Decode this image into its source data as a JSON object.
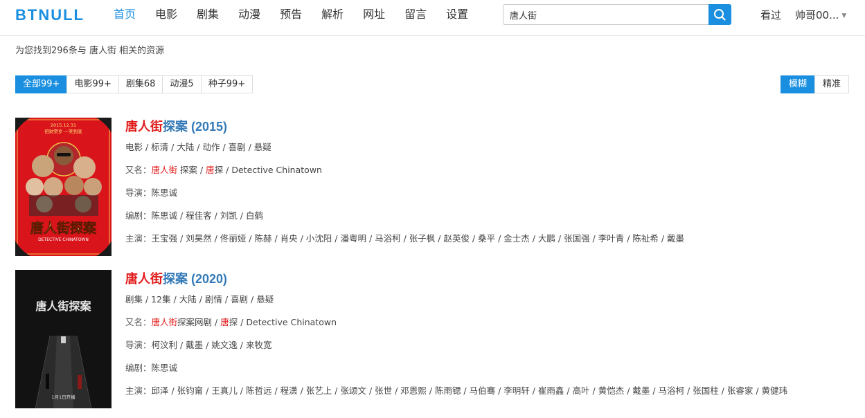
{
  "header": {
    "logo": "BTNULL",
    "nav": [
      "首页",
      "电影",
      "剧集",
      "动漫",
      "预告",
      "解析",
      "网址",
      "留言",
      "设置"
    ],
    "search_value": "唐人街",
    "history_label": "看过",
    "user_label": "帅哥00..."
  },
  "summary": {
    "prefix": "为您找到296条与 ",
    "keyword": "唐人街",
    "suffix": " 相关的资源"
  },
  "filters": [
    "全部99+",
    "电影99+",
    "剧集68",
    "动漫5",
    "种子99+"
  ],
  "modes": [
    "模糊",
    "精准"
  ],
  "results": [
    {
      "title_hl": "唐人街",
      "title_rest": "探案 (2015)",
      "meta": "电影 / 标清 / 大陆 / 动作 / 喜剧 / 悬疑",
      "aka_label": "又名：",
      "aka_hl1": "唐人街",
      "aka_mid": " 探案 / ",
      "aka_hl2": "唐",
      "aka_rest": "探 / Detective Chinatown",
      "director_label": "导演：",
      "director": "陈思诚",
      "writer_label": "编剧：",
      "writer": "陈思诚 / 程佳客 / 刘凯 / 白鹤",
      "cast_label": "主演：",
      "cast": "王宝强 / 刘昊然 / 佟丽娅 / 陈赫 / 肖央 / 小沈阳 / 潘粤明 / 马浴柯 / 张子枫 / 赵英俊 / 桑平 / 金士杰 / 大鹏 / 张国强 / 李叶青 / 陈祉希 / 戴墨",
      "poster_top": "2015.12.31",
      "poster_sub": "招财贺岁 一笑到底",
      "poster_title": "唐人街探案",
      "poster_en": "DETECTIVE CHINATOWN"
    },
    {
      "title_hl": "唐人街",
      "title_rest": "探案 (2020)",
      "meta": "剧集 / 12集 / 大陆 / 剧情 / 喜剧 / 悬疑",
      "aka_label": "又名：",
      "aka_hl1": "唐人街",
      "aka_mid": "探案网剧 / ",
      "aka_hl2": "唐",
      "aka_rest": "探 / Detective Chinatown",
      "director_label": "导演：",
      "director": "柯汶利 / 戴墨 / 姚文逸 / 来牧宽",
      "writer_label": "编剧：",
      "writer": "陈思诚",
      "cast_label": "主演：",
      "cast": "邱泽 / 张钧甯 / 王真儿 / 陈哲远 / 程潇 / 张艺上 / 张颂文 / 张世 / 邓恩熙 / 陈雨锶 / 马伯骞 / 李明轩 / 崔雨鑫 / 高叶 / 黄恺杰 / 戴墨 / 马浴柯 / 张国柱 / 张睿家 / 黄健玮",
      "poster_title": "唐人街探案",
      "poster_date": "1月1日开播"
    }
  ],
  "colors": {
    "accent": "#1a8fe0",
    "highlight": "#e21a1a",
    "title_link": "#337ab7"
  }
}
